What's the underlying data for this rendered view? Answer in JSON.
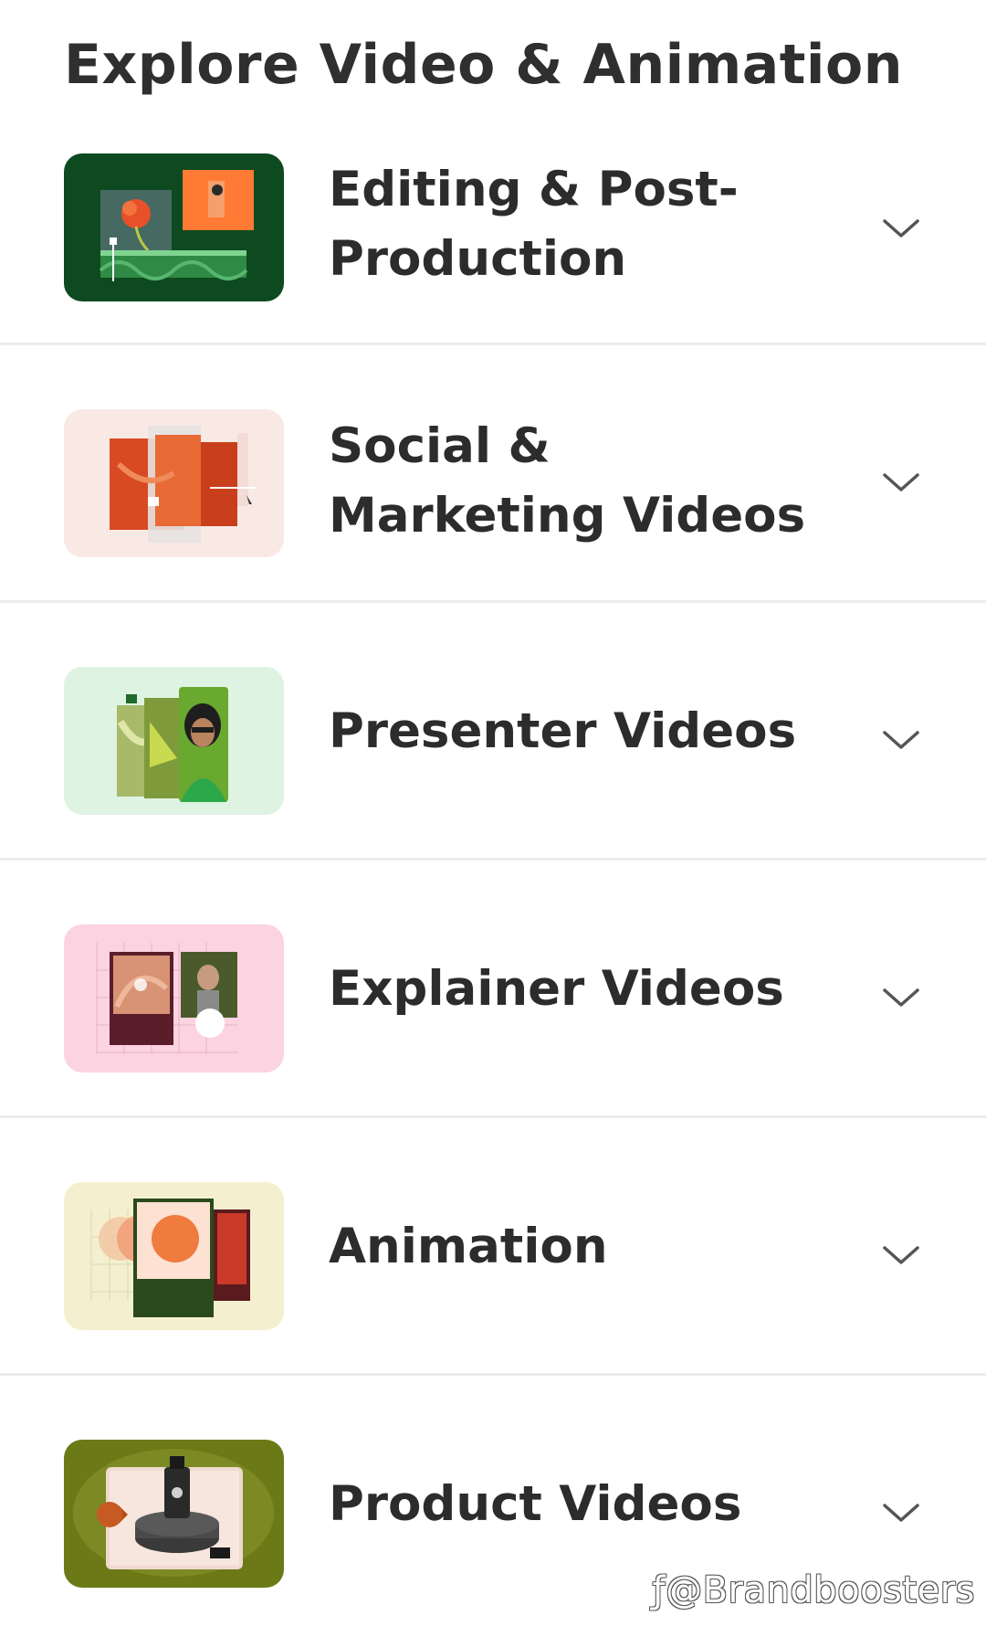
{
  "page": {
    "title": "Explore Video & Animation"
  },
  "categories": [
    {
      "label": "Editing & Post-Production",
      "thumbnail_icon": "editing-thumbnail",
      "bg": "#0d4a1f"
    },
    {
      "label": "Social & Marketing Videos",
      "thumbnail_icon": "social-thumbnail",
      "bg": "#f8e9e4"
    },
    {
      "label": "Presenter Videos",
      "thumbnail_icon": "presenter-thumbnail",
      "bg": "#dff3e2"
    },
    {
      "label": "Explainer Videos",
      "thumbnail_icon": "explainer-thumbnail",
      "bg": "#fcd3e1"
    },
    {
      "label": "Animation",
      "thumbnail_icon": "animation-thumbnail",
      "bg": "#f4f0cf"
    },
    {
      "label": "Product Videos",
      "thumbnail_icon": "product-thumbnail",
      "bg": "#6b7a16"
    }
  ],
  "watermark": {
    "text": "ƒ@Brandboosters"
  },
  "icons": {
    "expand": "chevron-down-icon"
  }
}
